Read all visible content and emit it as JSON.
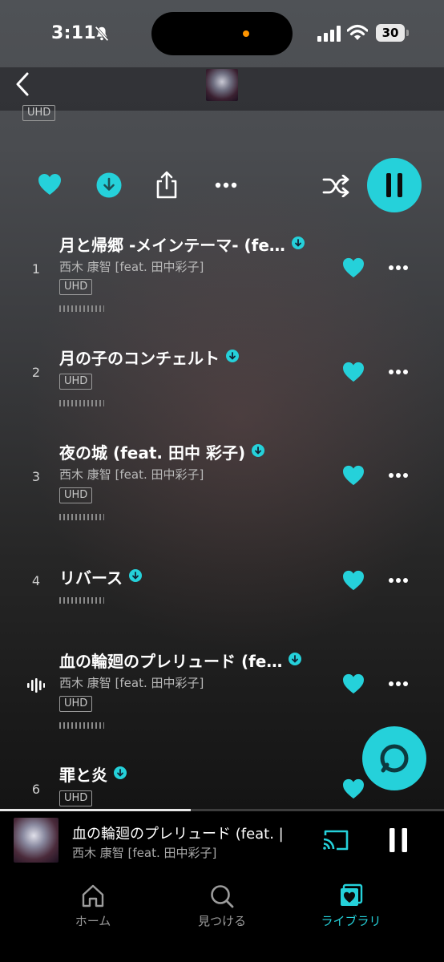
{
  "status_bar": {
    "time": "3:11",
    "battery": "30"
  },
  "album": {
    "top_badge": "UHD"
  },
  "colors": {
    "accent": "#25d1da",
    "background_top": "#4f5256",
    "background_bottom": "#141414"
  },
  "actions": {
    "icons": [
      "heart-icon",
      "download-icon",
      "share-icon",
      "more-icon",
      "shuffle-icon",
      "pause-icon"
    ]
  },
  "tracks": [
    {
      "number": "1",
      "title": "月と帰郷 -メインテーマ- (fe…",
      "artist": "西木 康智 [feat. 田中彩子]",
      "badge": "UHD"
    },
    {
      "number": "2",
      "title": "月の子のコンチェルト",
      "artist": "",
      "badge": "UHD"
    },
    {
      "number": "3",
      "title": "夜の城 (feat. 田中 彩子)",
      "artist": "西木 康智 [feat. 田中彩子]",
      "badge": "UHD"
    },
    {
      "number": "4",
      "title": "リバース",
      "artist": "",
      "badge": ""
    },
    {
      "number": "",
      "title": "血の輪廻のプレリュード (fe…",
      "artist": "西木 康智 [feat. 田中彩子]",
      "badge": "UHD",
      "playing": true
    },
    {
      "number": "6",
      "title": "罪と炎",
      "artist": "",
      "badge": "UHD"
    }
  ],
  "now_playing": {
    "title": "血の輪廻のプレリュード (feat. |",
    "artist": "西木 康智 [feat. 田中彩子]",
    "progress": 0.43
  },
  "tabs": [
    {
      "label": "ホーム",
      "icon": "home-icon",
      "active": false
    },
    {
      "label": "見つける",
      "icon": "search-icon",
      "active": false
    },
    {
      "label": "ライブラリ",
      "icon": "library-icon",
      "active": true
    }
  ]
}
